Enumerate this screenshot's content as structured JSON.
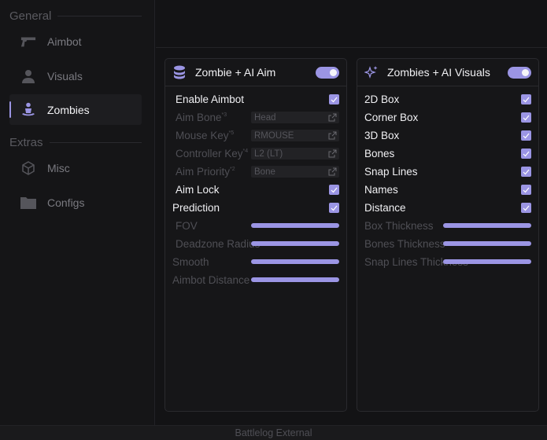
{
  "sidebar": {
    "sections": [
      {
        "heading": "General",
        "items": [
          {
            "label": "Aimbot",
            "icon": "pistol-icon"
          },
          {
            "label": "Visuals",
            "icon": "user-icon"
          },
          {
            "label": "Zombies",
            "icon": "zombie-icon",
            "active": true
          }
        ]
      },
      {
        "heading": "Extras",
        "items": [
          {
            "label": "Misc",
            "icon": "cube-icon"
          },
          {
            "label": "Configs",
            "icon": "folder-icon"
          }
        ]
      }
    ]
  },
  "aim_panel": {
    "title": "Zombie + AI Aim",
    "enabled": true,
    "enable_aimbot": {
      "label": "Enable Aimbot",
      "checked": true
    },
    "aim_bone": {
      "label": "Aim Bone",
      "hint": "*3",
      "value": "Head"
    },
    "mouse_key": {
      "label": "Mouse Key",
      "hint": "*5",
      "value": "RMOUSE"
    },
    "controller_key": {
      "label": "Controller Key",
      "hint": "*4",
      "value": "L2 (LT)"
    },
    "aim_priority": {
      "label": "Aim Priority",
      "hint": "*2",
      "value": "Bone"
    },
    "aim_lock": {
      "label": "Aim Lock",
      "checked": true
    },
    "prediction": {
      "label": "Prediction",
      "checked": true
    },
    "fov": {
      "label": "FOV",
      "fill": 1.0
    },
    "deadzone": {
      "label": "Deadzone Radius",
      "fill": 1.0
    },
    "smooth": {
      "label": "Smooth",
      "fill": 1.0
    },
    "distance": {
      "label": "Aimbot Distance",
      "fill": 1.0
    }
  },
  "visuals_panel": {
    "title": "Zombies + AI Visuals",
    "enabled": true,
    "box2d": {
      "label": "2D Box",
      "checked": true
    },
    "corner_box": {
      "label": "Corner Box",
      "checked": true
    },
    "box3d": {
      "label": "3D Box",
      "checked": true
    },
    "bones": {
      "label": "Bones",
      "checked": true
    },
    "snap_lines": {
      "label": "Snap Lines",
      "checked": true
    },
    "names": {
      "label": "Names",
      "checked": true
    },
    "distance": {
      "label": "Distance",
      "checked": true
    },
    "box_thickness": {
      "label": "Box Thickness",
      "fill": 1.0
    },
    "bones_thickness": {
      "label": "Bones Thickness",
      "fill": 1.0
    },
    "snap_thickness": {
      "label": "Snap Lines Thickness",
      "fill": 1.0
    }
  },
  "footer": {
    "text": "Battlelog External"
  },
  "colors": {
    "accent": "#9b95e4",
    "background": "#131315",
    "panel": "#161618",
    "dim_text": "#4f4f55"
  }
}
